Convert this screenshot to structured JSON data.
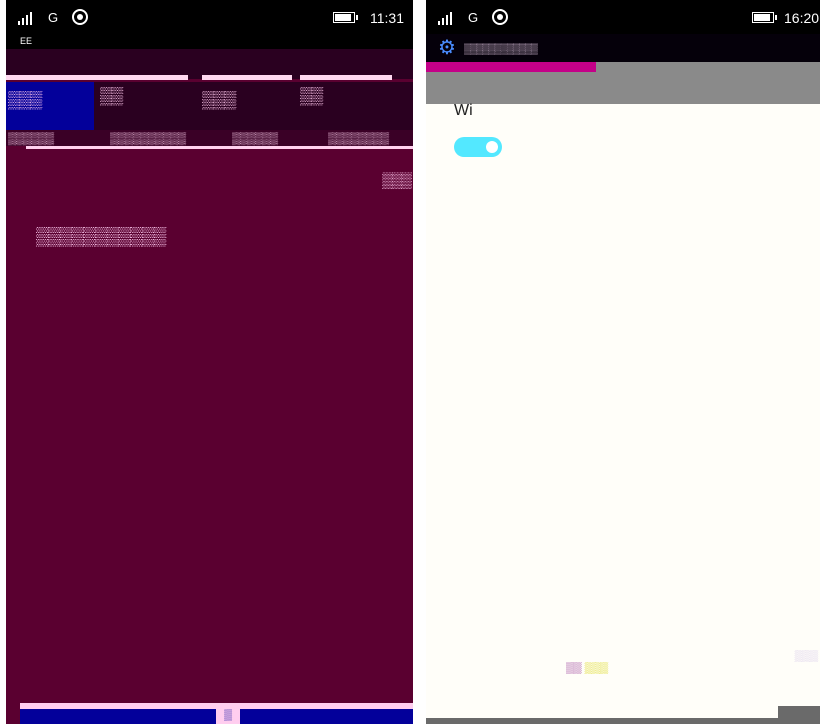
{
  "left_screen": {
    "status": {
      "network": "G",
      "time": "11:31"
    },
    "carrier": "EE",
    "tiles": [
      "▒▒▒",
      "▒▒",
      "▒▒▒",
      "▒▒"
    ],
    "tabs": [
      "▒▒▒▒▒▒",
      "▒▒▒▒▒▒▒▒▒▒",
      "▒▒▒▒▒▒",
      "▒▒▒▒▒▒▒▒"
    ],
    "link": "▒▒▒",
    "section_title": "▒▒▒▒▒▒▒▒▒▒▒",
    "bottom_key": "▒",
    "colors": {
      "background": "#5a0030",
      "accent": "#03009a",
      "text": "#ffcaf0"
    }
  },
  "right_screen": {
    "status": {
      "network": "G",
      "time": "16:20"
    },
    "header_title": "▒▒▒▒▒▒▒▒▒▒▒▒",
    "wifi_label": "Wi",
    "wifi_toggle": {
      "state": "on"
    },
    "footer": {
      "left": "▒▒",
      "right": "▒▒▒"
    },
    "colors": {
      "background": "#fffef9",
      "toggle": "#53e8ff"
    }
  }
}
